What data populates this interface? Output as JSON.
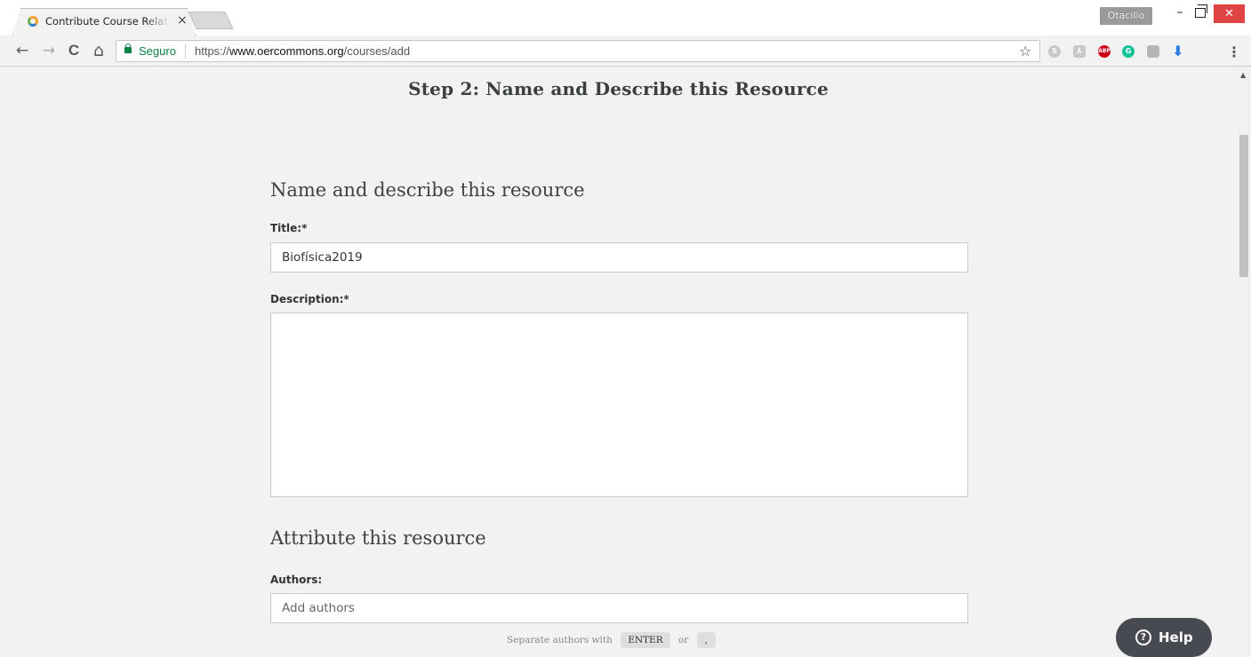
{
  "browser": {
    "tab_title": "Contribute Course Related",
    "tab_close": "×",
    "profile_name": "Otacilio",
    "window_controls": {
      "minimize": "–",
      "close": "✕"
    },
    "nav": {
      "back": "←",
      "forward": "→",
      "reload": "C",
      "home": "⌂"
    },
    "security_label": "Seguro",
    "url": {
      "scheme": "https://",
      "host": "www.oercommons.org",
      "path": "/courses/add"
    },
    "bookmark_icon": "☆",
    "menu_icon": "⋮",
    "extension_icons": [
      "skype-icon",
      "pdf-icon",
      "adblock-icon",
      "grammarly-icon",
      "extension-icon",
      "download-icon"
    ]
  },
  "page": {
    "step_title": "Step 2: Name and Describe this Resource",
    "section_describe": {
      "heading": "Name and describe this resource",
      "title_label": "Title:*",
      "title_value": "Biofísica2019",
      "description_label": "Description:*",
      "description_value": ""
    },
    "section_attribute": {
      "heading": "Attribute this resource",
      "authors_label": "Authors:",
      "authors_placeholder": "Add authors",
      "hint_text": "Separate authors with",
      "key_enter": "ENTER",
      "hint_or": "or",
      "key_comma": ","
    },
    "help_button": {
      "label": "Help",
      "icon": "?"
    }
  },
  "colors": {
    "page_bg": "#f1f2f1",
    "secure_green": "#0b8043",
    "help_bg": "#474b51",
    "close_red": "#e04343"
  }
}
